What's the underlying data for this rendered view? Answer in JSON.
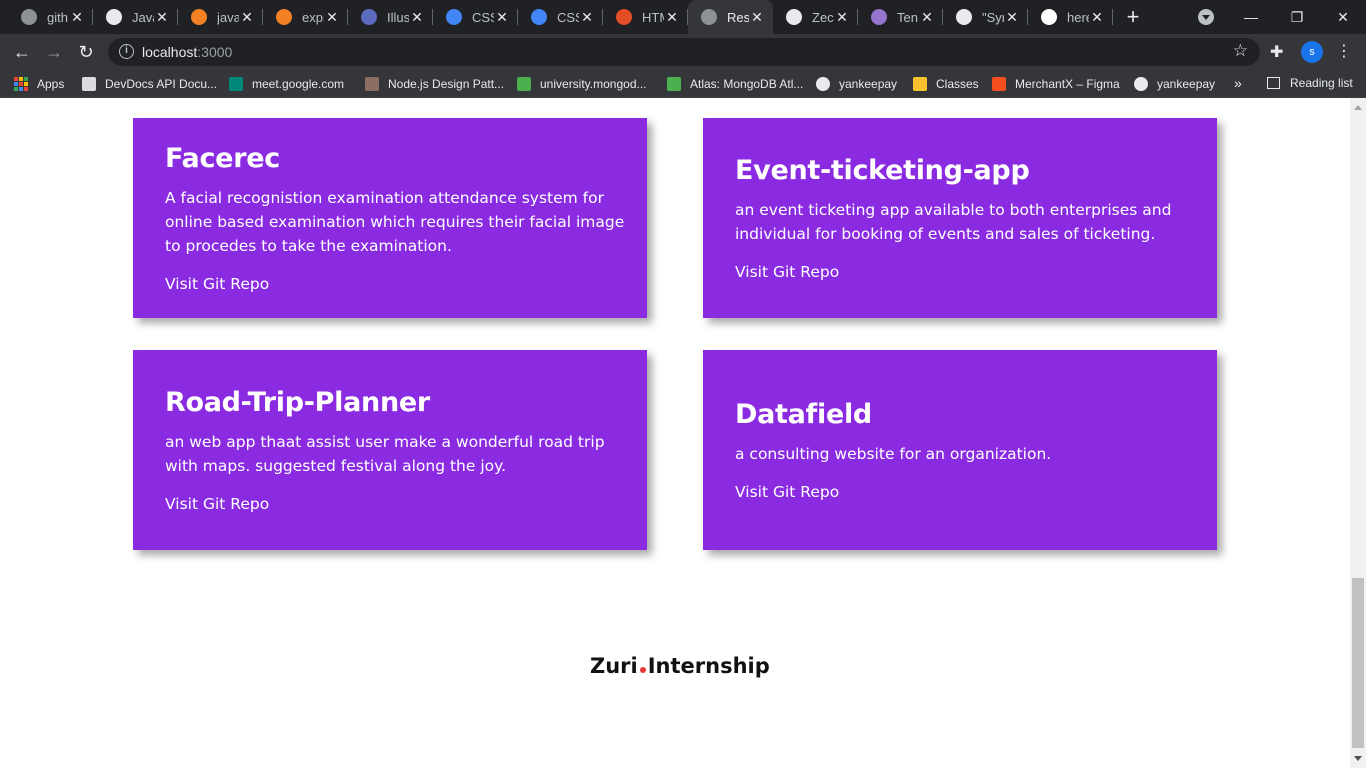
{
  "browser": {
    "tabs": [
      {
        "title": "gith",
        "icon": "globe-icon",
        "color": "#8e9196"
      },
      {
        "title": "Java",
        "icon": "github-icon",
        "color": "#e8eaed"
      },
      {
        "title": "java",
        "icon": "stackoverflow-icon",
        "color": "#f48024"
      },
      {
        "title": "expr",
        "icon": "stackoverflow-icon",
        "color": "#f48024"
      },
      {
        "title": "Illus",
        "icon": "person-icon",
        "color": "#5c6bc0"
      },
      {
        "title": "CSS",
        "icon": "css-icon",
        "color": "#4285f4"
      },
      {
        "title": "CSS",
        "icon": "css-icon",
        "color": "#4285f4"
      },
      {
        "title": "HTM",
        "icon": "html-icon",
        "color": "#e44d26"
      },
      {
        "title": "Res",
        "icon": "globe-icon",
        "color": "#8e9196"
      },
      {
        "title": "Zec",
        "icon": "github-icon",
        "color": "#e8eaed"
      },
      {
        "title": "Ten",
        "icon": "hackmd-icon",
        "color": "#9575cd"
      },
      {
        "title": "\"Syr",
        "icon": "github-icon",
        "color": "#e8eaed"
      },
      {
        "title": "here",
        "icon": "google-icon",
        "color": "#ffffff"
      }
    ],
    "active_tab_index": 8,
    "address": {
      "host": "localhost",
      "port": ":3000"
    },
    "profile_initial": "s",
    "bookmarks": [
      {
        "label": "Apps",
        "icon": "apps-grid-icon"
      },
      {
        "label": "DevDocs API Docu...",
        "icon": "devdocs-icon",
        "color": "#dadce0"
      },
      {
        "label": "meet.google.com",
        "icon": "meet-icon",
        "color": "#00897b"
      },
      {
        "label": "Node.js Design Patt...",
        "icon": "node-icon",
        "color": "#8d6e63"
      },
      {
        "label": "university.mongod...",
        "icon": "mongodb-leaf-icon",
        "color": "#4caf50"
      },
      {
        "label": "Atlas: MongoDB Atl...",
        "icon": "mongodb-leaf-icon",
        "color": "#4caf50"
      },
      {
        "label": "yankeepay",
        "icon": "globe-icon",
        "color": "#e8eaed"
      },
      {
        "label": "Classes",
        "icon": "classroom-icon",
        "color": "#fbc02d"
      },
      {
        "label": "MerchantX – Figma",
        "icon": "figma-icon",
        "color": "#f24e1e"
      },
      {
        "label": "yankeepay",
        "icon": "globe-icon",
        "color": "#e8eaed"
      }
    ],
    "bookmarks_more": "»",
    "reading_list": "Reading list"
  },
  "projects": [
    {
      "title": "Facerec",
      "description": "A facial recognistion examination attendance system for online based examination which requires their facial image to procedes to take the examination.",
      "link_label": "Visit Git Repo"
    },
    {
      "title": "Event-ticketing-app",
      "description": "an event ticketing app available to both enterprises and individual for booking of events and sales of ticketing.",
      "link_label": "Visit Git Repo"
    },
    {
      "title": "Road-Trip-Planner",
      "description": "an web app thaat assist user make a wonderful road trip with maps. suggested festival along the joy.",
      "link_label": "Visit Git Repo"
    },
    {
      "title": "Datafield",
      "description": "a consulting website for an organization.",
      "link_label": "Visit Git Repo"
    }
  ],
  "footer": {
    "brand_left": "Zuri",
    "brand_right": "Internship"
  },
  "colors": {
    "card_background": "#8a2be2",
    "brand_dot": "#e53935"
  }
}
